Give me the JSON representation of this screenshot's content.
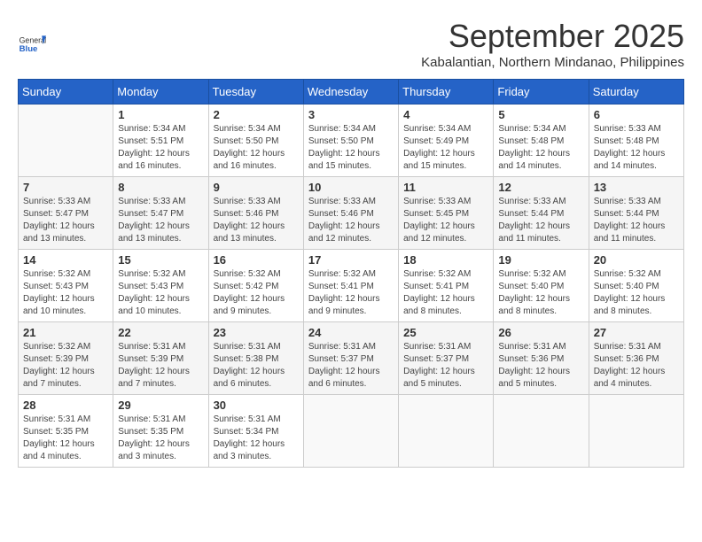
{
  "logo": {
    "general": "General",
    "blue": "Blue"
  },
  "header": {
    "month": "September 2025",
    "location": "Kabalantian, Northern Mindanao, Philippines"
  },
  "weekdays": [
    "Sunday",
    "Monday",
    "Tuesday",
    "Wednesday",
    "Thursday",
    "Friday",
    "Saturday"
  ],
  "weeks": [
    [
      {
        "day": "",
        "info": ""
      },
      {
        "day": "1",
        "info": "Sunrise: 5:34 AM\nSunset: 5:51 PM\nDaylight: 12 hours\nand 16 minutes."
      },
      {
        "day": "2",
        "info": "Sunrise: 5:34 AM\nSunset: 5:50 PM\nDaylight: 12 hours\nand 16 minutes."
      },
      {
        "day": "3",
        "info": "Sunrise: 5:34 AM\nSunset: 5:50 PM\nDaylight: 12 hours\nand 15 minutes."
      },
      {
        "day": "4",
        "info": "Sunrise: 5:34 AM\nSunset: 5:49 PM\nDaylight: 12 hours\nand 15 minutes."
      },
      {
        "day": "5",
        "info": "Sunrise: 5:34 AM\nSunset: 5:48 PM\nDaylight: 12 hours\nand 14 minutes."
      },
      {
        "day": "6",
        "info": "Sunrise: 5:33 AM\nSunset: 5:48 PM\nDaylight: 12 hours\nand 14 minutes."
      }
    ],
    [
      {
        "day": "7",
        "info": "Sunrise: 5:33 AM\nSunset: 5:47 PM\nDaylight: 12 hours\nand 13 minutes."
      },
      {
        "day": "8",
        "info": "Sunrise: 5:33 AM\nSunset: 5:47 PM\nDaylight: 12 hours\nand 13 minutes."
      },
      {
        "day": "9",
        "info": "Sunrise: 5:33 AM\nSunset: 5:46 PM\nDaylight: 12 hours\nand 13 minutes."
      },
      {
        "day": "10",
        "info": "Sunrise: 5:33 AM\nSunset: 5:46 PM\nDaylight: 12 hours\nand 12 minutes."
      },
      {
        "day": "11",
        "info": "Sunrise: 5:33 AM\nSunset: 5:45 PM\nDaylight: 12 hours\nand 12 minutes."
      },
      {
        "day": "12",
        "info": "Sunrise: 5:33 AM\nSunset: 5:44 PM\nDaylight: 12 hours\nand 11 minutes."
      },
      {
        "day": "13",
        "info": "Sunrise: 5:33 AM\nSunset: 5:44 PM\nDaylight: 12 hours\nand 11 minutes."
      }
    ],
    [
      {
        "day": "14",
        "info": "Sunrise: 5:32 AM\nSunset: 5:43 PM\nDaylight: 12 hours\nand 10 minutes."
      },
      {
        "day": "15",
        "info": "Sunrise: 5:32 AM\nSunset: 5:43 PM\nDaylight: 12 hours\nand 10 minutes."
      },
      {
        "day": "16",
        "info": "Sunrise: 5:32 AM\nSunset: 5:42 PM\nDaylight: 12 hours\nand 9 minutes."
      },
      {
        "day": "17",
        "info": "Sunrise: 5:32 AM\nSunset: 5:41 PM\nDaylight: 12 hours\nand 9 minutes."
      },
      {
        "day": "18",
        "info": "Sunrise: 5:32 AM\nSunset: 5:41 PM\nDaylight: 12 hours\nand 8 minutes."
      },
      {
        "day": "19",
        "info": "Sunrise: 5:32 AM\nSunset: 5:40 PM\nDaylight: 12 hours\nand 8 minutes."
      },
      {
        "day": "20",
        "info": "Sunrise: 5:32 AM\nSunset: 5:40 PM\nDaylight: 12 hours\nand 8 minutes."
      }
    ],
    [
      {
        "day": "21",
        "info": "Sunrise: 5:32 AM\nSunset: 5:39 PM\nDaylight: 12 hours\nand 7 minutes."
      },
      {
        "day": "22",
        "info": "Sunrise: 5:31 AM\nSunset: 5:39 PM\nDaylight: 12 hours\nand 7 minutes."
      },
      {
        "day": "23",
        "info": "Sunrise: 5:31 AM\nSunset: 5:38 PM\nDaylight: 12 hours\nand 6 minutes."
      },
      {
        "day": "24",
        "info": "Sunrise: 5:31 AM\nSunset: 5:37 PM\nDaylight: 12 hours\nand 6 minutes."
      },
      {
        "day": "25",
        "info": "Sunrise: 5:31 AM\nSunset: 5:37 PM\nDaylight: 12 hours\nand 5 minutes."
      },
      {
        "day": "26",
        "info": "Sunrise: 5:31 AM\nSunset: 5:36 PM\nDaylight: 12 hours\nand 5 minutes."
      },
      {
        "day": "27",
        "info": "Sunrise: 5:31 AM\nSunset: 5:36 PM\nDaylight: 12 hours\nand 4 minutes."
      }
    ],
    [
      {
        "day": "28",
        "info": "Sunrise: 5:31 AM\nSunset: 5:35 PM\nDaylight: 12 hours\nand 4 minutes."
      },
      {
        "day": "29",
        "info": "Sunrise: 5:31 AM\nSunset: 5:35 PM\nDaylight: 12 hours\nand 3 minutes."
      },
      {
        "day": "30",
        "info": "Sunrise: 5:31 AM\nSunset: 5:34 PM\nDaylight: 12 hours\nand 3 minutes."
      },
      {
        "day": "",
        "info": ""
      },
      {
        "day": "",
        "info": ""
      },
      {
        "day": "",
        "info": ""
      },
      {
        "day": "",
        "info": ""
      }
    ]
  ]
}
